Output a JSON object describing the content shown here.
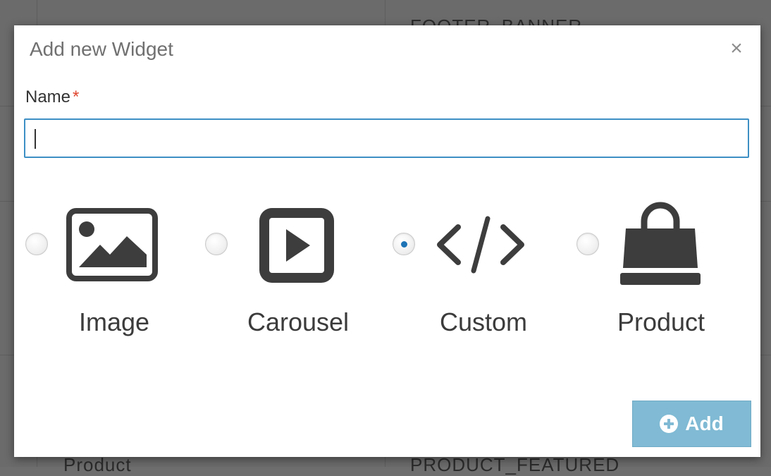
{
  "background": {
    "top_text": "FOOTER_BANNER",
    "bottom_left_text": "Product",
    "bottom_right_text": "PRODUCT_FEATURED"
  },
  "modal": {
    "title": "Add new Widget",
    "close_glyph": "×",
    "name_field": {
      "label": "Name",
      "required_marker": "*",
      "value": "",
      "placeholder": ""
    },
    "widget_types": [
      {
        "label": "Image",
        "icon": "image-icon",
        "selected": false
      },
      {
        "label": "Carousel",
        "icon": "carousel-play-icon",
        "selected": false
      },
      {
        "label": "Custom",
        "icon": "code-icon",
        "selected": true
      },
      {
        "label": "Product",
        "icon": "shopping-bag-icon",
        "selected": false
      }
    ],
    "add_button": {
      "label": "Add",
      "icon": "plus-circle-icon"
    }
  },
  "colors": {
    "overlay": "#6e6e6e",
    "input_focus_border": "#3d8fc4",
    "radio_selected": "#1d73b5",
    "add_button_bg": "#80bad4",
    "required_star": "#e0452f",
    "icon_color": "#3d3d3d"
  }
}
